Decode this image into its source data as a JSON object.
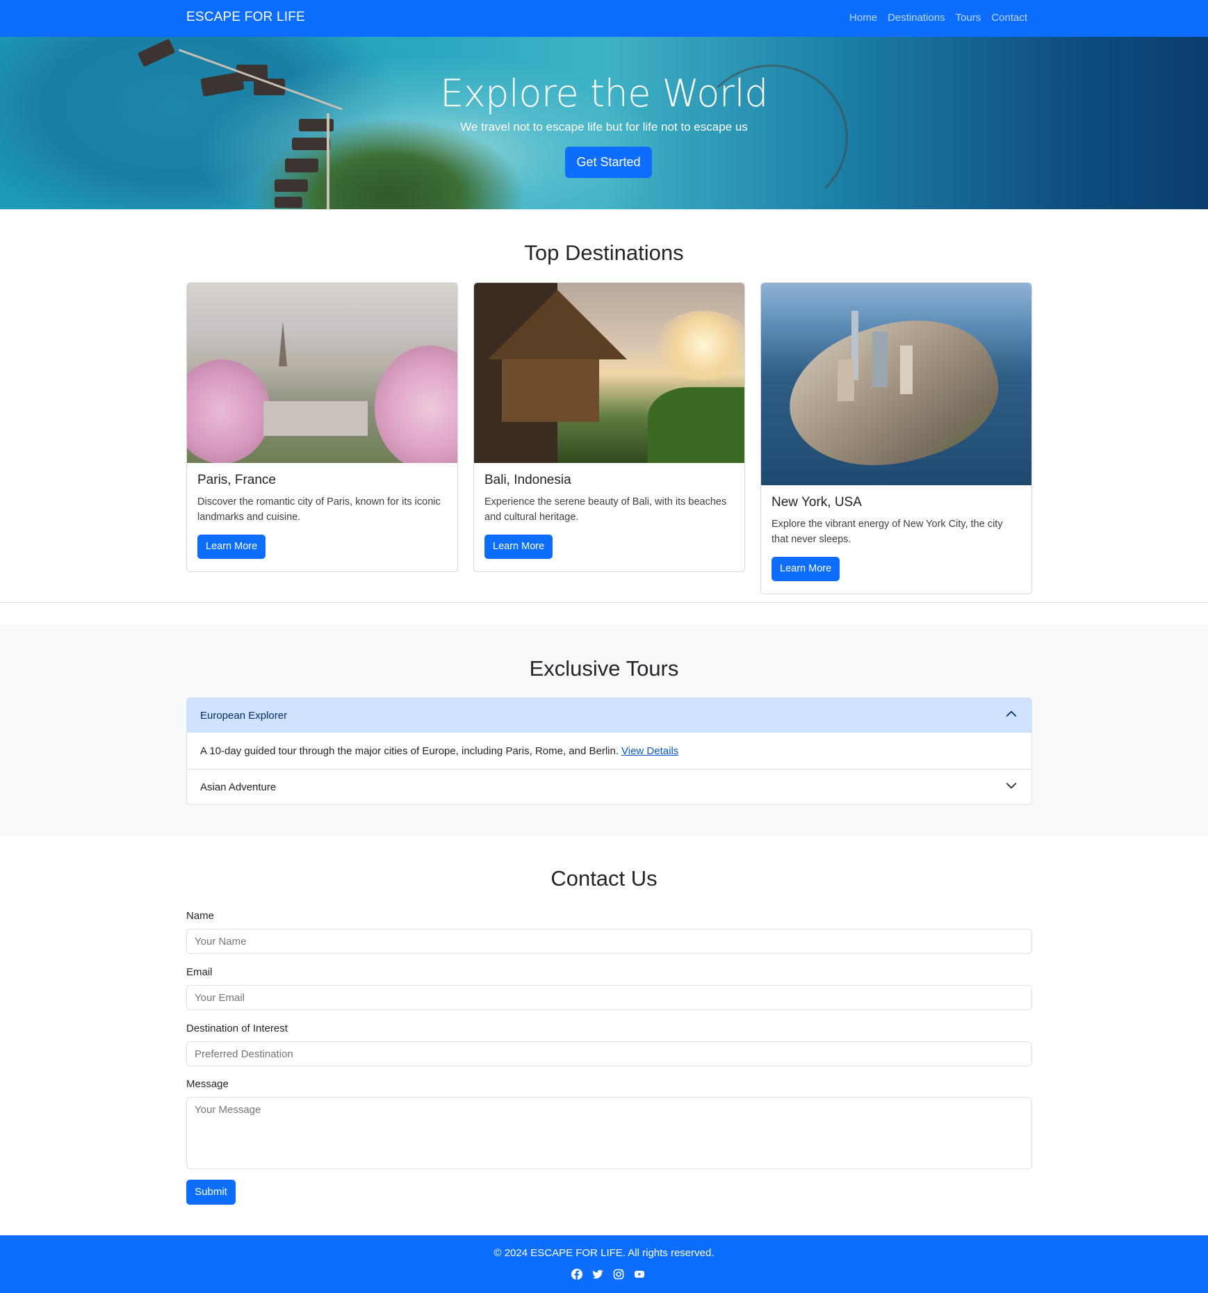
{
  "navbar": {
    "brand": "ESCAPE FOR LIFE",
    "links": [
      "Home",
      "Destinations",
      "Tours",
      "Contact"
    ]
  },
  "hero": {
    "title": "Explore the World",
    "subtitle": "We travel not to escape life but for life not to escape us",
    "cta": "Get Started"
  },
  "destinations": {
    "title": "Top Destinations",
    "cards": [
      {
        "title": "Paris, France",
        "text": "Discover the romantic city of Paris, known for its iconic landmarks and cuisine.",
        "button": "Learn More"
      },
      {
        "title": "Bali, Indonesia",
        "text": "Experience the serene beauty of Bali, with its beaches and cultural heritage.",
        "button": "Learn More"
      },
      {
        "title": "New York, USA",
        "text": "Explore the vibrant energy of New York City, the city that never sleeps.",
        "button": "Learn More"
      }
    ]
  },
  "tours": {
    "title": "Exclusive Tours",
    "items": [
      {
        "title": "European Explorer",
        "body": "A 10-day guided tour through the major cities of Europe, including Paris, Rome, and Berlin.",
        "link": "View Details",
        "expanded": true
      },
      {
        "title": "Asian Adventure",
        "expanded": false
      }
    ]
  },
  "contact": {
    "title": "Contact Us",
    "fields": [
      {
        "label": "Name",
        "placeholder": "Your Name"
      },
      {
        "label": "Email",
        "placeholder": "Your Email"
      },
      {
        "label": "Destination of Interest",
        "placeholder": "Preferred Destination"
      },
      {
        "label": "Message",
        "placeholder": "Your Message"
      }
    ],
    "submit": "Submit"
  },
  "footer": {
    "copyright": "© 2024 ESCAPE FOR LIFE. All rights reserved.",
    "socials": [
      "facebook-icon",
      "twitter-icon",
      "instagram-icon",
      "youtube-icon"
    ]
  },
  "colors": {
    "primary": "#0d6efd",
    "accordion_active": "#cfe2ff",
    "section_bg": "#f8f9fa"
  }
}
